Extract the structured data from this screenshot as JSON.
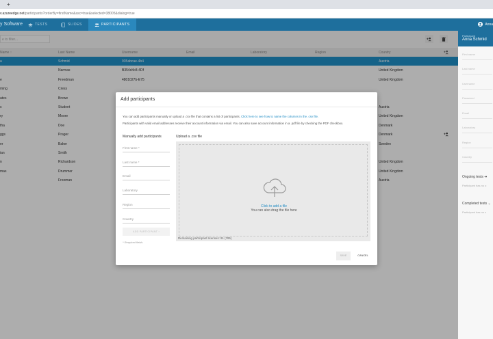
{
  "browser": {
    "newtab_label": "+",
    "url_host": "v.azureedge.net",
    "url_path": "/participants?orderBy=firstName&asc=true&selected=38005&dialog=true"
  },
  "appbar": {
    "brand": "y Software",
    "nav": [
      {
        "label": "TESTS",
        "icon": "graduation-cap-icon"
      },
      {
        "label": "SLIDES",
        "icon": "slides-icon"
      },
      {
        "label": "PARTICIPANTS",
        "icon": "participants-icon"
      }
    ],
    "user_label": "Anna"
  },
  "toolbar": {
    "filter_placeholder": "e to filter...",
    "add_icon": "add-user-icon",
    "delete_icon": "trash-icon"
  },
  "table": {
    "headers": [
      "Name ↑",
      "Last Name",
      "Username",
      "Email",
      "Laboratory",
      "Region",
      "Country"
    ],
    "header_icon": "add-user-icon",
    "rows": [
      {
        "first": "a",
        "last": "Schmid",
        "username": "935abcae-4b4",
        "country": "Austria",
        "selected": true
      },
      {
        "first": "",
        "last": "Narmax",
        "username": "B354d4c8-4Df",
        "country": "United Kingdom"
      },
      {
        "first": "e",
        "last": "Freedman",
        "username": "4801027b-E75",
        "country": "United Kingdom"
      },
      {
        "first": "ming",
        "last": "Cress",
        "username": "",
        "country": ""
      },
      {
        "first": "ates",
        "last": "Brewe",
        "username": "",
        "country": ""
      },
      {
        "first": "s",
        "last": "Student",
        "username": "",
        "country": "Austria"
      },
      {
        "first": "ry",
        "last": "Moore",
        "username": "",
        "country": "United Kingdom"
      },
      {
        "first": "tha",
        "last": "Doe",
        "username": "",
        "country": "Denmark"
      },
      {
        "first": "ggs",
        "last": "Prager",
        "username": "",
        "country": "Denmark",
        "row_icon": true
      },
      {
        "first": "er",
        "last": "Baker",
        "username": "",
        "country": "Sweden"
      },
      {
        "first": "ian",
        "last": "Smith",
        "username": "",
        "country": ""
      },
      {
        "first": "n",
        "last": "Richardson",
        "username": "",
        "country": "United Kingdom"
      },
      {
        "first": "mas",
        "last": "Drummer",
        "username": "",
        "country": "United Kingdom"
      },
      {
        "first": "",
        "last": "Freeman",
        "username": "",
        "country": "Austria"
      }
    ]
  },
  "side_panel": {
    "subtitle": "Participant",
    "name": "Anna Schmid",
    "fields": [
      "First name",
      "Last name",
      "Username",
      "Password",
      "Email",
      "Laboratory",
      "Region",
      "Country"
    ],
    "ongoing_title": "Ongoing tests",
    "ongoing_note": "Participant has no o",
    "completed_title": "Completed tests",
    "completed_note": "Participant has no c"
  },
  "dialog": {
    "title": "Add participants",
    "intro_1": "You can add participants manually or upload a .csv file that contains a list of participants.",
    "intro_link": "Click here to see how to name the columns in the .csv file.",
    "intro_2": "Participants with valid email addresses receive their account information via email. You can also save account information in a .pdf file by checking the PDF checkbox.",
    "manual_title": "Manually add participants",
    "upload_title": "Upload a .csv file",
    "fields": [
      "First name *",
      "Last name *",
      "Email",
      "Laboratory",
      "Region",
      "Country"
    ],
    "add_button": "ADD PARTICIPANT",
    "required_note": "* Required fields",
    "drop_click": "Click to add a file",
    "drop_drag": "You can also drag the file here",
    "remaining": "Remaining participant licenses: 91 (785)",
    "save": "SAVE",
    "cancel": "CANCEL"
  }
}
